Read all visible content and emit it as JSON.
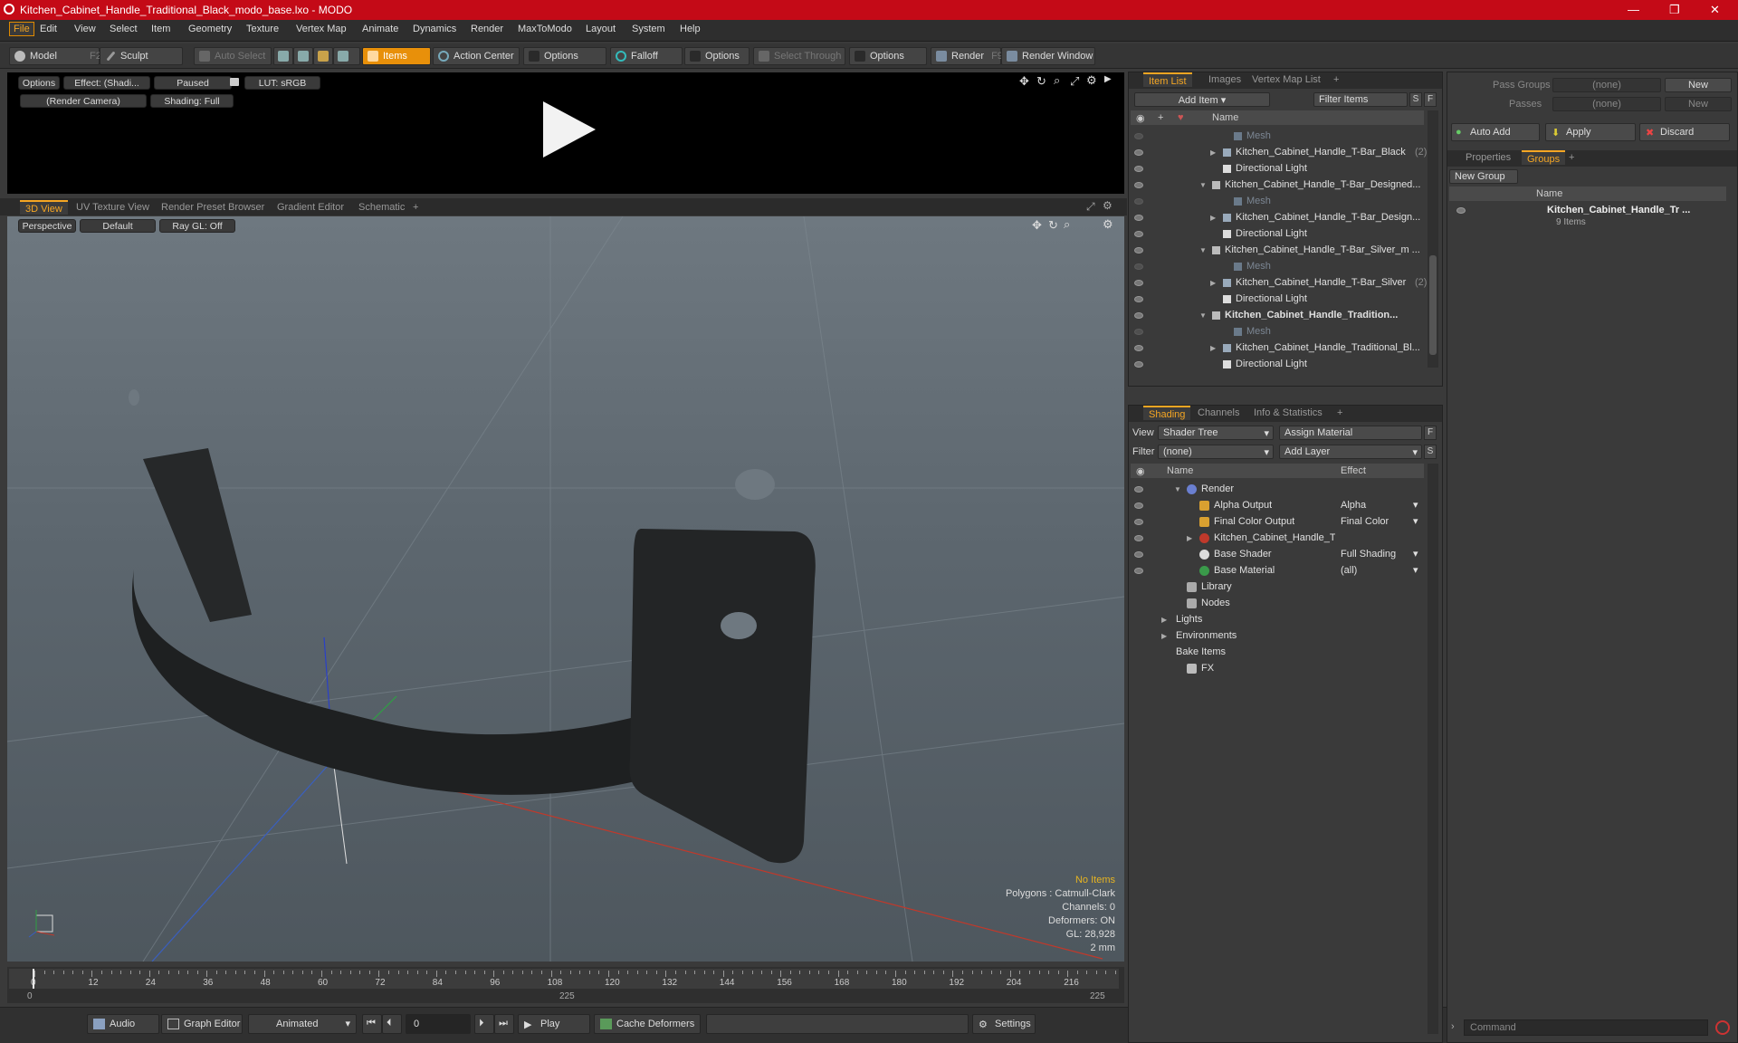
{
  "window": {
    "title": "Kitchen_Cabinet_Handle_Traditional_Black_modo_base.lxo - MODO"
  },
  "menu": [
    "File",
    "Edit",
    "View",
    "Select",
    "Item",
    "Geometry",
    "Texture",
    "Vertex Map",
    "Animate",
    "Dynamics",
    "Render",
    "MaxToModo",
    "Layout",
    "System",
    "Help"
  ],
  "toolbar": {
    "model": "Model",
    "model_key": "F2",
    "sculpt": "Sculpt",
    "auto_select": "Auto Select",
    "items": "Items",
    "action_center": "Action Center",
    "options1": "Options",
    "falloff": "Falloff",
    "options2": "Options",
    "select_through": "Select Through",
    "options3": "Options",
    "render": "Render",
    "render_key": "F9",
    "render_window": "Render Window"
  },
  "preview": {
    "options": "Options",
    "effect": "Effect: (Shadi...",
    "paused": "Paused",
    "lut": "LUT: sRGB",
    "camera": "(Render Camera)",
    "shading": "Shading: Full"
  },
  "viewport_tabs": [
    "3D View",
    "UV Texture View",
    "Render Preset Browser",
    "Gradient Editor",
    "Schematic",
    "+"
  ],
  "viewport": {
    "perspective": "Perspective",
    "default": "Default",
    "raygl": "Ray GL: Off",
    "no_items": "No Items",
    "polygons": "Polygons : Catmull-Clark",
    "channels": "Channels: 0",
    "deformers": "Deformers: ON",
    "gl": "GL: 28,928",
    "scale": "2 mm"
  },
  "timeline": {
    "ticks": [
      "0",
      "12",
      "24",
      "36",
      "48",
      "60",
      "72",
      "84",
      "96",
      "108",
      "120",
      "132",
      "144",
      "156",
      "168",
      "180",
      "192",
      "204",
      "216"
    ],
    "start": "0",
    "mid": "225",
    "end": "225"
  },
  "bottom": {
    "audio": "Audio",
    "graph_editor": "Graph Editor",
    "animated": "Animated",
    "frame": "0",
    "play": "Play",
    "cache_deformers": "Cache Deformers",
    "settings": "Settings",
    "command_placeholder": "Command"
  },
  "item_list": {
    "tabs": [
      "Item List",
      "Images",
      "Vertex Map List",
      "+"
    ],
    "add_item": "Add Item",
    "filter_items": "Filter Items",
    "s": "S",
    "f": "F",
    "col_name": "Name",
    "rows": [
      {
        "label": "Mesh",
        "indent": 3,
        "type": "mesh"
      },
      {
        "label": "Kitchen_Cabinet_Handle_T-Bar_Black",
        "suffix": "(2)",
        "indent": 2,
        "type": "group",
        "arrow": "right"
      },
      {
        "label": "Directional Light",
        "indent": 2,
        "type": "light"
      },
      {
        "label": "Kitchen_Cabinet_Handle_T-Bar_Designed...",
        "indent": 1,
        "type": "scene",
        "arrow": "down"
      },
      {
        "label": "Mesh",
        "indent": 3,
        "type": "mesh"
      },
      {
        "label": "Kitchen_Cabinet_Handle_T-Bar_Design...",
        "indent": 2,
        "type": "group",
        "arrow": "right"
      },
      {
        "label": "Directional Light",
        "indent": 2,
        "type": "light"
      },
      {
        "label": "Kitchen_Cabinet_Handle_T-Bar_Silver_m ...",
        "indent": 1,
        "type": "scene",
        "arrow": "down"
      },
      {
        "label": "Mesh",
        "indent": 3,
        "type": "mesh"
      },
      {
        "label": "Kitchen_Cabinet_Handle_T-Bar_Silver",
        "suffix": "(2)",
        "indent": 2,
        "type": "group",
        "arrow": "right"
      },
      {
        "label": "Directional Light",
        "indent": 2,
        "type": "light"
      },
      {
        "label": "Kitchen_Cabinet_Handle_Tradition...",
        "indent": 1,
        "type": "scene",
        "arrow": "down",
        "bold": true
      },
      {
        "label": "Mesh",
        "indent": 3,
        "type": "mesh"
      },
      {
        "label": "Kitchen_Cabinet_Handle_Traditional_Bl...",
        "indent": 2,
        "type": "group",
        "arrow": "right"
      },
      {
        "label": "Directional Light",
        "indent": 2,
        "type": "light"
      }
    ]
  },
  "shading": {
    "tabs": [
      "Shading",
      "Channels",
      "Info & Statistics",
      "+"
    ],
    "view_label": "View",
    "view_value": "Shader Tree",
    "assign_material": "Assign Material",
    "filter_label": "Filter",
    "filter_value": "(none)",
    "add_layer": "Add Layer",
    "f": "F",
    "s": "S",
    "col_name": "Name",
    "col_effect": "Effect",
    "rows": [
      {
        "label": "Render",
        "effect": "",
        "indent": 1,
        "icon": "render",
        "arrow": "down"
      },
      {
        "label": "Alpha Output",
        "effect": "Alpha",
        "indent": 2,
        "icon": "output"
      },
      {
        "label": "Final Color Output",
        "effect": "Final Color",
        "indent": 2,
        "icon": "output"
      },
      {
        "label": "Kitchen_Cabinet_Handle_T ...",
        "effect": "",
        "indent": 2,
        "icon": "material-group",
        "arrow": "right"
      },
      {
        "label": "Base Shader",
        "effect": "Full Shading",
        "indent": 2,
        "icon": "shader"
      },
      {
        "label": "Base Material",
        "effect": "(all)",
        "indent": 2,
        "icon": "material"
      },
      {
        "label": "Library",
        "effect": "",
        "indent": 1,
        "icon": "folder"
      },
      {
        "label": "Nodes",
        "effect": "",
        "indent": 1,
        "icon": "folder"
      },
      {
        "label": "Lights",
        "effect": "",
        "indent": 0,
        "arrow": "right"
      },
      {
        "label": "Environments",
        "effect": "",
        "indent": 0,
        "arrow": "right"
      },
      {
        "label": "Bake Items",
        "effect": "",
        "indent": 0
      },
      {
        "label": "FX",
        "effect": "",
        "indent": 1,
        "icon": "fx"
      }
    ]
  },
  "right": {
    "pass_groups": "Pass Groups",
    "pass_value": "(none)",
    "new": "New",
    "passes": "Passes",
    "passes_value": "(none)",
    "new2": "New",
    "auto_add": "Auto Add",
    "apply": "Apply",
    "discard": "Discard",
    "tabs": [
      "Properties",
      "Groups",
      "+"
    ],
    "new_group": "New Group",
    "col_name": "Name",
    "group_name": "Kitchen_Cabinet_Handle_Tr ...",
    "group_items": "9 Items"
  }
}
